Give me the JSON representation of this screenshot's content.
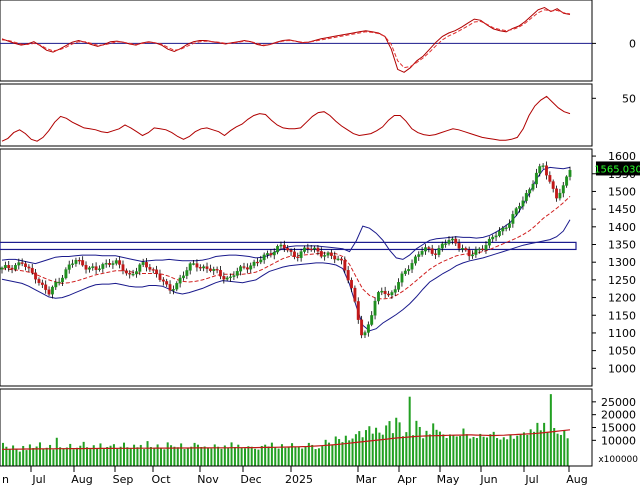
{
  "chart_data": {
    "type": "candlestick",
    "months": [
      "Jul",
      "Aug",
      "Sep",
      "Oct",
      "Nov",
      "Dec",
      "2025",
      "Mar",
      "Apr",
      "May",
      "Jun",
      "Jul",
      "Aug"
    ],
    "price": {
      "ylim": [
        950,
        1620
      ],
      "ticks": [
        1000,
        1050,
        1100,
        1150,
        1200,
        1250,
        1300,
        1350,
        1400,
        1450,
        1500,
        1550,
        1600
      ],
      "last_value": 1565,
      "last_label": "1565.030",
      "resistance_zone": [
        1336,
        1356
      ],
      "closes": [
        1280,
        1286,
        1292,
        1298,
        1276,
        1262,
        1232,
        1210,
        1238,
        1262,
        1286,
        1306,
        1296,
        1284,
        1276,
        1290,
        1302,
        1298,
        1282,
        1262,
        1278,
        1292,
        1286,
        1272,
        1248,
        1216,
        1238,
        1262,
        1286,
        1294,
        1286,
        1280,
        1272,
        1262,
        1252,
        1270,
        1284,
        1292,
        1296,
        1312,
        1326,
        1338,
        1346,
        1328,
        1318,
        1330,
        1340,
        1336,
        1322,
        1316,
        1312,
        1302,
        1242,
        1168,
        1082,
        1136,
        1196,
        1224,
        1204,
        1232,
        1262,
        1292,
        1316,
        1336,
        1332,
        1328,
        1352,
        1360,
        1356,
        1338,
        1316,
        1330,
        1346,
        1360,
        1378,
        1394,
        1418,
        1446,
        1476,
        1510,
        1552,
        1572,
        1526,
        1488,
        1508,
        1565
      ],
      "bb_upper": [
        1306,
        1308,
        1308,
        1304,
        1300,
        1296,
        1302,
        1308,
        1314,
        1316,
        1316,
        1318,
        1320,
        1320,
        1320,
        1318,
        1318,
        1318,
        1314,
        1310,
        1306,
        1302,
        1304,
        1306,
        1306,
        1308,
        1306,
        1304,
        1304,
        1304,
        1306,
        1310,
        1316,
        1318,
        1320,
        1320,
        1318,
        1316,
        1312,
        1314,
        1320,
        1330,
        1338,
        1344,
        1346,
        1346,
        1346,
        1346,
        1344,
        1342,
        1340,
        1338,
        1330,
        1360,
        1402,
        1396,
        1382,
        1362,
        1334,
        1312,
        1308,
        1320,
        1338,
        1350,
        1362,
        1366,
        1368,
        1370,
        1372,
        1370,
        1370,
        1368,
        1370,
        1376,
        1386,
        1398,
        1412,
        1432,
        1462,
        1498,
        1536,
        1562,
        1568,
        1566,
        1564,
        1568
      ],
      "bb_lower": [
        1252,
        1248,
        1244,
        1240,
        1232,
        1222,
        1212,
        1202,
        1198,
        1200,
        1206,
        1214,
        1222,
        1230,
        1236,
        1238,
        1238,
        1240,
        1236,
        1232,
        1230,
        1230,
        1234,
        1234,
        1232,
        1224,
        1214,
        1210,
        1214,
        1220,
        1226,
        1234,
        1242,
        1248,
        1246,
        1244,
        1242,
        1246,
        1250,
        1262,
        1274,
        1280,
        1286,
        1290,
        1292,
        1294,
        1296,
        1298,
        1298,
        1296,
        1292,
        1282,
        1238,
        1176,
        1122,
        1106,
        1112,
        1128,
        1140,
        1152,
        1166,
        1182,
        1202,
        1224,
        1244,
        1256,
        1268,
        1278,
        1290,
        1298,
        1304,
        1308,
        1312,
        1318,
        1324,
        1330,
        1336,
        1342,
        1348,
        1352,
        1356,
        1360,
        1364,
        1372,
        1388,
        1420
      ],
      "ma": [
        1282,
        1280,
        1278,
        1276,
        1272,
        1266,
        1258,
        1250,
        1244,
        1240,
        1242,
        1246,
        1252,
        1258,
        1264,
        1268,
        1272,
        1276,
        1276,
        1274,
        1270,
        1268,
        1268,
        1268,
        1266,
        1260,
        1252,
        1246,
        1244,
        1246,
        1250,
        1256,
        1262,
        1266,
        1266,
        1266,
        1266,
        1268,
        1272,
        1280,
        1290,
        1300,
        1310,
        1316,
        1318,
        1320,
        1322,
        1324,
        1326,
        1326,
        1324,
        1316,
        1294,
        1258,
        1224,
        1206,
        1198,
        1196,
        1198,
        1206,
        1218,
        1232,
        1248,
        1264,
        1280,
        1292,
        1302,
        1310,
        1318,
        1322,
        1324,
        1326,
        1330,
        1336,
        1344,
        1352,
        1360,
        1368,
        1378,
        1390,
        1406,
        1424,
        1438,
        1452,
        1468,
        1486
      ]
    },
    "oscillator": {
      "ylim": [
        -65,
        75
      ],
      "ticks": [
        0
      ],
      "values": [
        8,
        4,
        0,
        -3,
        -1,
        3,
        -4,
        -12,
        -15,
        -10,
        -4,
        2,
        5,
        2,
        -2,
        -5,
        -2,
        3,
        4,
        2,
        -1,
        -3,
        1,
        3,
        1,
        -3,
        -10,
        -14,
        -9,
        -2,
        3,
        5,
        5,
        3,
        1,
        -1,
        1,
        3,
        5,
        3,
        -2,
        -4,
        -2,
        2,
        5,
        6,
        4,
        1,
        2,
        5,
        8,
        10,
        12,
        14,
        16,
        18,
        20,
        22,
        20,
        18,
        12,
        -10,
        -45,
        -50,
        -42,
        -30,
        -22,
        -10,
        2,
        12,
        18,
        22,
        28,
        35,
        42,
        40,
        32,
        25,
        22,
        20,
        26,
        30,
        38,
        48,
        58,
        62,
        55,
        60,
        52,
        50
      ],
      "signal": [
        6,
        5,
        2,
        -1,
        -2,
        0,
        -3,
        -9,
        -13,
        -11,
        -7,
        -1,
        3,
        3,
        0,
        -3,
        -3,
        0,
        3,
        2,
        0,
        -2,
        0,
        2,
        1,
        -1,
        -7,
        -12,
        -10,
        -5,
        0,
        3,
        4,
        3,
        2,
        0,
        0,
        2,
        4,
        3,
        0,
        -3,
        -2,
        1,
        4,
        5,
        4,
        2,
        2,
        4,
        6,
        8,
        10,
        12,
        14,
        16,
        18,
        20,
        19,
        17,
        12,
        -2,
        -30,
        -42,
        -40,
        -33,
        -25,
        -15,
        -4,
        6,
        13,
        18,
        24,
        30,
        37,
        38,
        33,
        27,
        24,
        22,
        24,
        28,
        35,
        44,
        53,
        58,
        56,
        57,
        53,
        51
      ]
    },
    "rsi": {
      "ylim": [
        0,
        65
      ],
      "ticks": [
        50
      ],
      "values": [
        5,
        8,
        14,
        17,
        13,
        7,
        5,
        9,
        16,
        25,
        31,
        29,
        25,
        22,
        19,
        18,
        17,
        15,
        14,
        16,
        18,
        22,
        19,
        15,
        11,
        14,
        19,
        18,
        17,
        14,
        10,
        7,
        10,
        15,
        18,
        19,
        17,
        15,
        11,
        16,
        20,
        23,
        28,
        32,
        34,
        33,
        27,
        22,
        19,
        18,
        18,
        19,
        25,
        31,
        35,
        36,
        32,
        26,
        21,
        17,
        13,
        11,
        12,
        13,
        16,
        20,
        27,
        32,
        32,
        26,
        18,
        14,
        12,
        11,
        12,
        14,
        16,
        18,
        17,
        15,
        13,
        11,
        9,
        8,
        7,
        6,
        6,
        7,
        9,
        18,
        32,
        42,
        48,
        52,
        46,
        40,
        36,
        34
      ]
    },
    "volume": {
      "ylim": [
        0,
        30000
      ],
      "ticks": [
        10000,
        15000,
        20000,
        25000
      ],
      "unit_label": "x100000",
      "bars": [
        9000,
        7500,
        6500,
        8000,
        6800,
        5600,
        7800,
        6200,
        8400,
        7000,
        7600,
        9200,
        6800,
        7100,
        8200,
        6400,
        11000,
        7300,
        6900,
        7200,
        8600,
        6500,
        7100,
        7900,
        9400,
        7300,
        6600,
        8100,
        7000,
        8800,
        6600,
        7400,
        7900,
        8500,
        6700,
        7500,
        9100,
        7300,
        6900,
        8300,
        7300,
        8200,
        6600,
        9700,
        7400,
        7100,
        8400,
        7000,
        6500,
        9200,
        8100,
        7500,
        7300,
        8800,
        6600,
        7000,
        7500,
        9000,
        8300,
        7400,
        7600,
        7000,
        6800,
        8400,
        7500,
        6700,
        8000,
        7100,
        9200,
        7400,
        8300,
        7100,
        6900,
        7700,
        7500,
        6700,
        6400,
        7800,
        8300,
        7600,
        9100,
        7200,
        6800,
        8500,
        7100,
        7300,
        8900,
        7300,
        7600,
        6800,
        7700,
        9000,
        8200,
        6600,
        6900,
        7800,
        10200,
        9100,
        8300,
        11500,
        10500,
        9300,
        11800,
        10000,
        10700,
        12400,
        13600,
        11200,
        14000,
        15500,
        12600,
        14900,
        13000,
        12200,
        15800,
        17500,
        12800,
        18800,
        17000,
        11600,
        13200,
        27000,
        12000,
        17600,
        15200,
        10800,
        13700,
        12300,
        16600,
        14100,
        13400,
        12300,
        10900,
        12300,
        11900,
        11500,
        11700,
        14600,
        12400,
        10700,
        11300,
        10900,
        12500,
        11400,
        11100,
        12400,
        13300,
        10900,
        10300,
        11200,
        10400,
        12200,
        10600,
        11800,
        12300,
        13100,
        12100,
        14300,
        13300,
        16800,
        13900,
        16800,
        13200,
        28000,
        14800,
        12600,
        12100,
        13900,
        10800
      ],
      "ma": [
        6500,
        6520,
        6550,
        6580,
        6600,
        6620,
        6640,
        6650,
        6670,
        6690,
        6700,
        6720,
        6730,
        6740,
        6750,
        6760,
        6770,
        6790,
        6800,
        6820,
        6830,
        6840,
        6850,
        6860,
        6870,
        6880,
        6890,
        6900,
        6910,
        6920,
        6930,
        6940,
        6950,
        6960,
        6970,
        6980,
        6990,
        7000,
        7010,
        7020,
        7030,
        7040,
        7050,
        7060,
        7070,
        7080,
        7090,
        7100,
        7110,
        7120,
        7130,
        7140,
        7150,
        7160,
        7170,
        7200,
        7230,
        7260,
        7290,
        7320,
        7350,
        7400,
        7450,
        7500,
        7550,
        7600,
        7700,
        7800,
        7900,
        8050,
        8200,
        8350,
        8500,
        8700,
        8900,
        9100,
        9300,
        9500,
        9700,
        9900,
        10100,
        10300,
        10500,
        10700,
        10900,
        11050,
        11200,
        11350,
        11500,
        11600,
        11700,
        11750,
        11800,
        11850,
        11900,
        11950,
        12000,
        12050,
        12050,
        12100,
        12100,
        12050,
        12000,
        11950,
        11900,
        11900,
        11950,
        12000,
        12100,
        12200,
        12300,
        12400,
        12500,
        12600,
        12750,
        12900,
        13100,
        13300,
        13500,
        13700,
        13900,
        14100
      ]
    }
  }
}
